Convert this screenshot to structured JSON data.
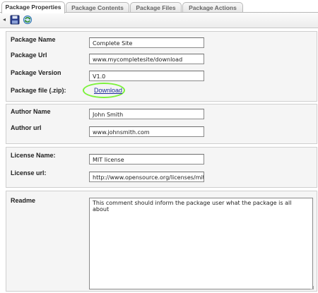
{
  "tabs": [
    {
      "label": "Package Properties",
      "active": true
    },
    {
      "label": "Package Contents",
      "active": false
    },
    {
      "label": "Package Files",
      "active": false
    },
    {
      "label": "Package Actions",
      "active": false
    }
  ],
  "toolbar": {
    "icons": [
      "save-icon",
      "refresh-icon"
    ]
  },
  "package": {
    "name_label": "Package Name",
    "name_value": "Complete Site",
    "url_label": "Package Url",
    "url_value": "www.mycompletesite/download",
    "version_label": "Package Version",
    "version_value": "V1.0",
    "file_label": "Package file (.zip):",
    "file_link": "Download"
  },
  "author": {
    "name_label": "Author Name",
    "name_value": "John Smith",
    "url_label": "Author url",
    "url_value": "www.johnsmith.com"
  },
  "license": {
    "name_label": "License Name:",
    "name_value": "MIT license",
    "url_label": "License url:",
    "url_value": "http://www.opensource.org/licenses/mit"
  },
  "readme": {
    "label": "Readme",
    "value": "This comment should inform the package user what the package is all about"
  },
  "colors": {
    "highlight": "#7cf23b",
    "link": "#1a2a9a",
    "panel_bg": "#f5f5f5"
  }
}
